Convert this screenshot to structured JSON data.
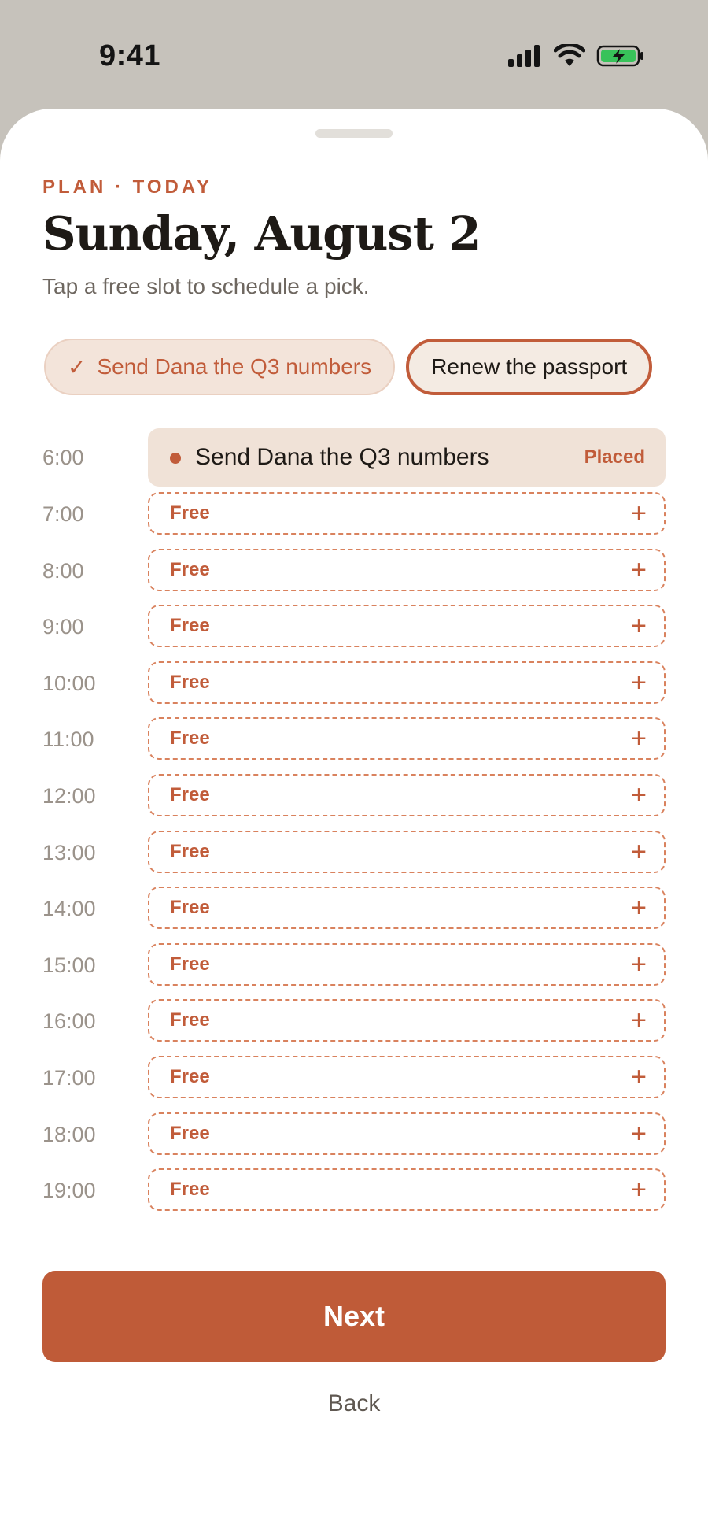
{
  "status_bar": {
    "time": "9:41",
    "icons": [
      "cellular-signal-icon",
      "wifi-icon",
      "battery-charging-icon"
    ]
  },
  "header": {
    "eyebrow": "PLAN · TODAY",
    "title": "Sunday, August 2",
    "subtitle": "Tap a free slot to schedule a pick."
  },
  "picks": [
    {
      "label": "Send Dana the Q3 numbers",
      "state": "done",
      "check": "✓"
    },
    {
      "label": "Renew the passport",
      "state": "active"
    }
  ],
  "schedule": {
    "placed": {
      "hour": "6:00",
      "task": "Send Dana the Q3 numbers",
      "status": "Placed"
    },
    "free_label": "Free",
    "plus": "+",
    "free_hours": [
      "7:00",
      "8:00",
      "9:00",
      "10:00",
      "11:00",
      "12:00",
      "13:00",
      "14:00",
      "15:00",
      "16:00",
      "17:00",
      "18:00",
      "19:00"
    ]
  },
  "actions": {
    "next": "Next",
    "back": "Back"
  },
  "colors": {
    "accent": "#bf5b38",
    "chip_bg": "#f3e4da",
    "placed_bg": "#f0e2d7",
    "backdrop": "#c6c2bb"
  }
}
